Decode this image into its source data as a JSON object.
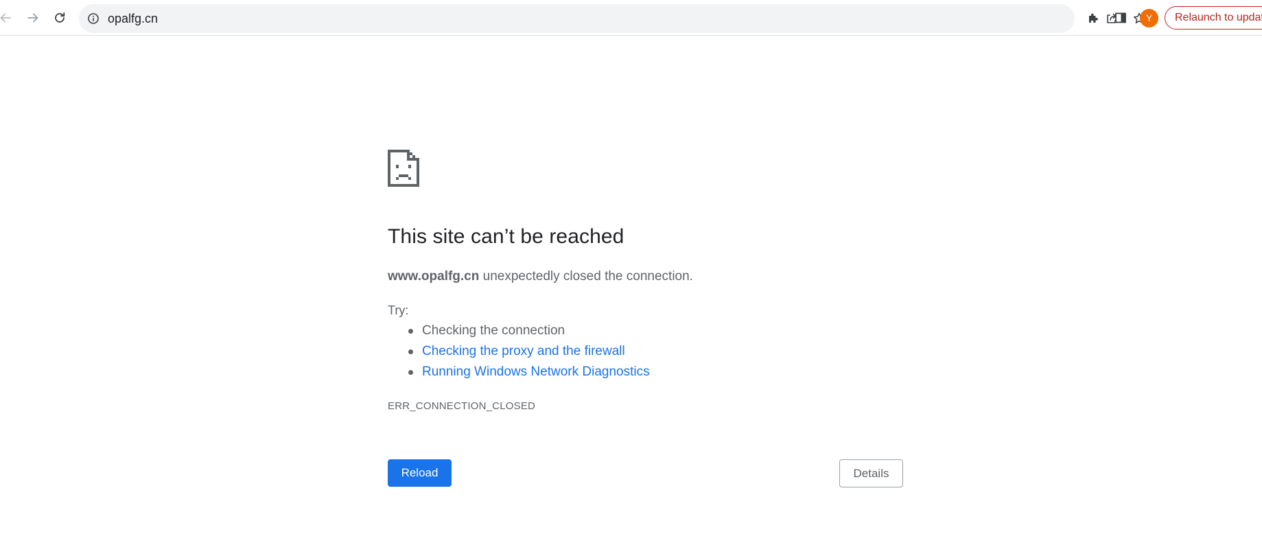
{
  "browser": {
    "url": "opalfg.cn",
    "relaunch_label": "Relaunch to update",
    "avatar_letter": "Y",
    "icons": {
      "back": "arrow-left-icon",
      "forward": "arrow-right-icon",
      "reload": "reload-icon",
      "site_info": "info-icon",
      "share": "share-icon",
      "bookmark": "star-icon",
      "extensions": "puzzle-icon",
      "side_panel": "side-panel-icon"
    },
    "colors": {
      "avatar": "#f06d05",
      "relaunch": "#c5221f"
    }
  },
  "error_page": {
    "title": "This site can’t be reached",
    "summary_host": "www.opalfg.cn",
    "summary_rest": " unexpectedly closed the connection.",
    "try_label": "Try:",
    "suggestions": [
      "Checking the connection",
      "Checking the proxy and the firewall",
      "Running Windows Network Diagnostics"
    ],
    "error_code": "ERR_CONNECTION_CLOSED",
    "reload_label": "Reload",
    "details_label": "Details",
    "icon": "sad-page-icon",
    "colors": {
      "primary": "#1a73e8",
      "text": "#5f6368",
      "heading": "#202124"
    }
  }
}
